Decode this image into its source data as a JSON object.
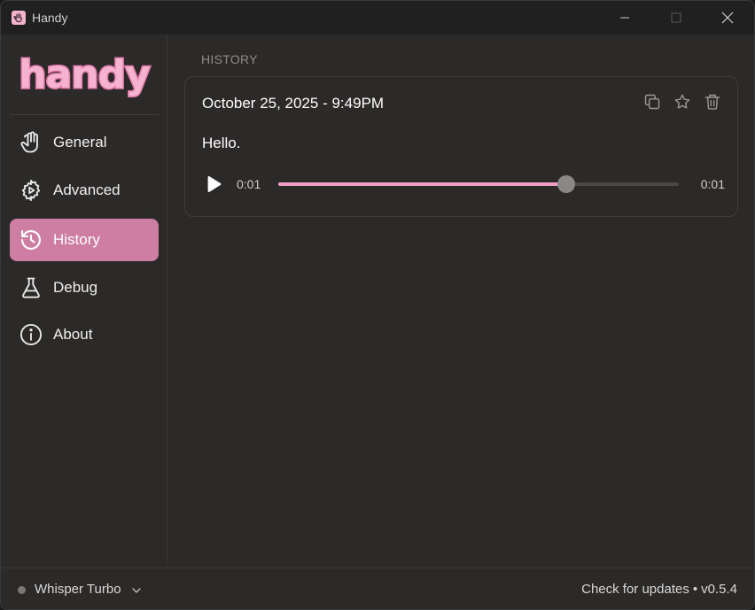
{
  "window": {
    "title": "Handy",
    "app_icon": "hand-icon",
    "controls": [
      "minimize-icon",
      "maximize-icon",
      "close-icon"
    ]
  },
  "sidebar": {
    "logo_text": "handy",
    "items": [
      {
        "label": "General",
        "icon": "hand-icon",
        "active": false
      },
      {
        "label": "Advanced",
        "icon": "gear-play-icon",
        "active": false
      },
      {
        "label": "History",
        "icon": "history-icon",
        "active": true
      },
      {
        "label": "Debug",
        "icon": "flask-icon",
        "active": false
      },
      {
        "label": "About",
        "icon": "info-icon",
        "active": false
      }
    ]
  },
  "main": {
    "section_title": "HISTORY",
    "entries": [
      {
        "datetime": "October 25, 2025 - 9:49PM",
        "text": "Hello.",
        "actions": [
          "copy-icon",
          "star-icon",
          "trash-icon"
        ],
        "player": {
          "current_time": "0:01",
          "duration": "0:01",
          "progress": 0.72
        }
      }
    ]
  },
  "footer": {
    "model": "Whisper Turbo",
    "update_link": "Check for updates",
    "separator": "•",
    "version": "v0.5.4"
  },
  "colors": {
    "accent": "#cf7ea3",
    "progress": "#f19dc4",
    "background": "#2c2a29",
    "titlebar": "#202020"
  }
}
